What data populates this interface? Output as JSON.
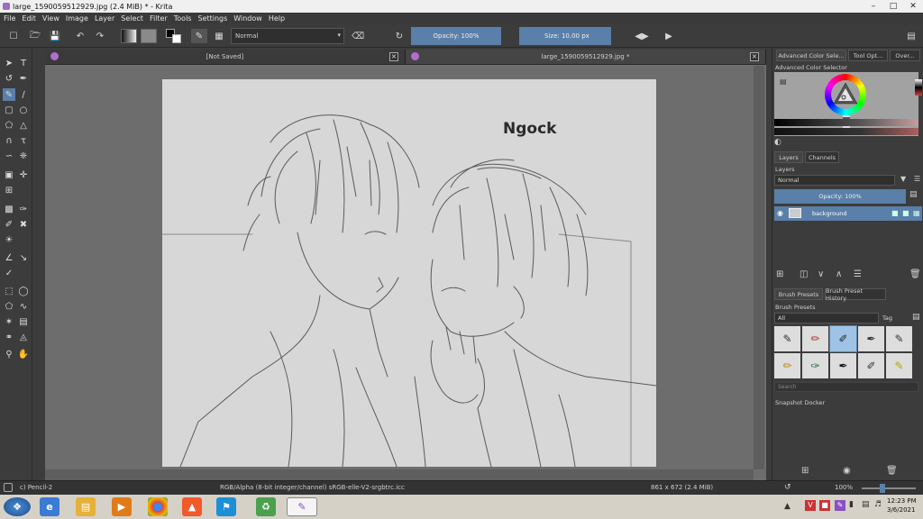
{
  "window": {
    "title": "large_1590059512929.jpg (2.4 MiB)  * - Krita"
  },
  "menu": [
    "File",
    "Edit",
    "View",
    "Image",
    "Layer",
    "Select",
    "Filter",
    "Tools",
    "Settings",
    "Window",
    "Help"
  ],
  "toolbar": {
    "blend_mode": "Normal",
    "opacity": "Opacity: 100%",
    "size": "Size: 10.00 px"
  },
  "tabs": [
    {
      "title": "[Not Saved]"
    },
    {
      "title": "large_1590059512929.jpg *"
    }
  ],
  "canvas": {
    "signature": "Ngock"
  },
  "dock": {
    "color_tabs": [
      "Advanced Color Sele...",
      "Tool Opt...",
      "Over..."
    ],
    "color_title": "Advanced Color Selector",
    "layer_tabs": [
      "Layers",
      "Channels"
    ],
    "layers_title": "Layers",
    "layer_blend": "Normal",
    "layer_opacity": "Opacity:  100%",
    "layer_name": "background",
    "brush_tabs": [
      "Brush Presets",
      "Brush Preset History"
    ],
    "brush_title": "Brush Presets",
    "brush_filter": "All",
    "brush_tag": "Tag",
    "search_placeholder": "Search",
    "snapshot_title": "Snapshot Docker"
  },
  "status": {
    "brush": "c) Pencil-2",
    "color_space": "RGB/Alpha (8-bit integer/channel)  sRGB-elle-V2-srgbtrc.icc",
    "dimensions": "861 x 672 (2.4 MiB)",
    "zoom": "100%"
  },
  "taskbar": {
    "time": "12:23 PM",
    "date": "3/6/2021"
  },
  "colors": {
    "accent": "#5a7fa8",
    "canvas_bg": "#6d6d6d",
    "paper": "#d7d7d7",
    "ui_bg": "#3c3c3c"
  }
}
